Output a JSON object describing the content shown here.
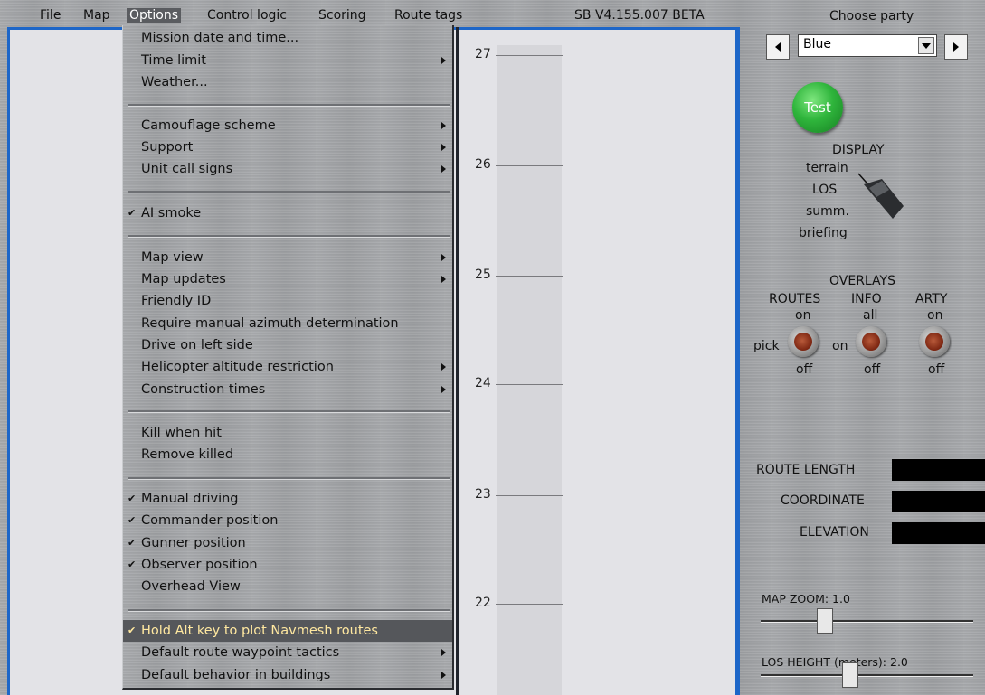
{
  "menubar": {
    "items": [
      "File",
      "Map",
      "Options",
      "Control logic",
      "Scoring",
      "Route tags"
    ],
    "version": "SB V4.155.007 BETA"
  },
  "options_menu": {
    "items": [
      {
        "label": "Mission date and time...",
        "checked": false,
        "submenu": false
      },
      {
        "label": "Time limit",
        "checked": false,
        "submenu": true
      },
      {
        "label": "Weather...",
        "checked": false,
        "submenu": false
      },
      {
        "label": "Camouflage scheme",
        "checked": false,
        "submenu": true
      },
      {
        "label": "Support",
        "checked": false,
        "submenu": true
      },
      {
        "label": "Unit call signs",
        "checked": false,
        "submenu": true
      },
      {
        "label": "AI smoke",
        "checked": true,
        "submenu": false
      },
      {
        "label": "Map view",
        "checked": false,
        "submenu": true
      },
      {
        "label": "Map updates",
        "checked": false,
        "submenu": true
      },
      {
        "label": "Friendly ID",
        "checked": false,
        "submenu": false
      },
      {
        "label": "Require manual azimuth determination",
        "checked": false,
        "submenu": false
      },
      {
        "label": "Drive on left side",
        "checked": false,
        "submenu": false
      },
      {
        "label": "Helicopter altitude restriction",
        "checked": false,
        "submenu": true
      },
      {
        "label": "Construction times",
        "checked": false,
        "submenu": true
      },
      {
        "label": "Kill when hit",
        "checked": false,
        "submenu": false
      },
      {
        "label": "Remove killed",
        "checked": false,
        "submenu": false
      },
      {
        "label": "Manual driving",
        "checked": true,
        "submenu": false
      },
      {
        "label": "Commander position",
        "checked": true,
        "submenu": false
      },
      {
        "label": "Gunner position",
        "checked": true,
        "submenu": false
      },
      {
        "label": "Observer position",
        "checked": true,
        "submenu": false
      },
      {
        "label": "Overhead View",
        "checked": false,
        "submenu": false
      },
      {
        "label": "Hold Alt key to plot Navmesh routes",
        "checked": true,
        "submenu": false,
        "highlighted": true
      },
      {
        "label": "Default route waypoint tactics",
        "checked": false,
        "submenu": true
      },
      {
        "label": "Default behavior in buildings",
        "checked": false,
        "submenu": true
      }
    ],
    "check_glyph": "✔"
  },
  "map": {
    "ticks": [
      "27",
      "26",
      "25",
      "24",
      "23",
      "22"
    ]
  },
  "right_panel": {
    "choose_party_label": "Choose party",
    "party_value": "Blue",
    "test_label": "Test",
    "display": {
      "title": "DISPLAY",
      "options": [
        "terrain",
        "LOS",
        "summ.",
        "briefing"
      ]
    },
    "overlays": {
      "title": "OVERLAYS",
      "routes": {
        "label": "ROUTES",
        "top": "on",
        "left": "pick",
        "bottom": "off"
      },
      "info": {
        "label": "INFO",
        "top": "all",
        "left": "on",
        "bottom": "off"
      },
      "arty": {
        "label": "ARTY",
        "top": "on",
        "bottom": "off"
      }
    },
    "route_length_label": "ROUTE LENGTH",
    "coordinate_label": "COORDINATE",
    "elevation_label": "ELEVATION",
    "map_zoom_label": "MAP ZOOM:  1.0",
    "map_zoom_value": 0.3,
    "los_height_label": "LOS HEIGHT (meters):  2.0",
    "los_height_value": 0.42
  },
  "colors": {
    "frame_blue": "#1d66c8",
    "highlight_bg": "#55575b",
    "highlight_text": "#ffe8a0",
    "test_green": "#2fb53c"
  }
}
